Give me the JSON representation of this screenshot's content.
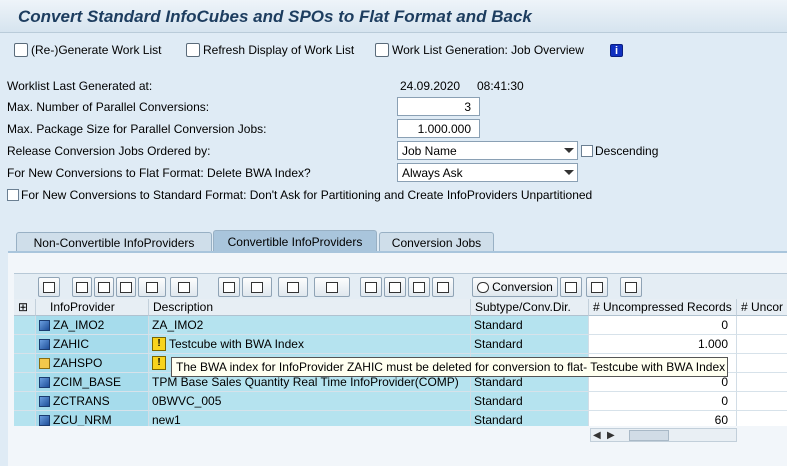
{
  "window": {
    "title": "Convert Standard InfoCubes and SPOs to Flat Format and Back"
  },
  "appbar": {
    "regen": "(Re-)Generate Work List",
    "refresh": "Refresh Display of Work List",
    "joboverview": "Work List Generation: Job Overview"
  },
  "form": {
    "last_generated_label": "Worklist Last Generated at:",
    "last_generated_date": "24.09.2020",
    "last_generated_time": "08:41:30",
    "max_parallel_label": "Max. Number of Parallel Conversions:",
    "max_parallel_value": "3",
    "max_package_label": "Max. Package Size for Parallel Conversion Jobs:",
    "max_package_value": "1.000.000",
    "release_order_label": "Release Conversion Jobs Ordered by:",
    "release_order_value": "Job Name",
    "descending_label": "Descending",
    "delete_bwa_label": "For New Conversions to Flat Format: Delete BWA Index?",
    "delete_bwa_value": "Always Ask",
    "partitioning_label": "For New Conversions to Standard Format: Don't Ask for Partitioning and Create InfoProviders Unpartitioned"
  },
  "tabs": [
    {
      "label": "Non-Convertible InfoProviders"
    },
    {
      "label": "Convertible InfoProviders"
    },
    {
      "label": "Conversion Jobs"
    }
  ],
  "toolbar": {
    "conversion": "Conversion"
  },
  "table": {
    "headers": [
      "InfoProvider",
      "Description",
      "Subtype/Conv.Dir.",
      "# Uncompressed Records",
      "# Uncor"
    ],
    "rows": [
      {
        "provider": "ZA_IMO2",
        "description": "ZA_IMO2",
        "subtype": "Standard",
        "records": "0"
      },
      {
        "provider": "ZAHIC",
        "description": "Testcube with BWA Index",
        "subtype": "Standard",
        "records": "1.000"
      },
      {
        "provider": "ZAHSPO",
        "description": "",
        "subtype": "",
        "records": ""
      },
      {
        "provider": "ZCIM_BASE",
        "description": "TPM Base Sales Quantity Real Time InfoProvider(COMP)",
        "subtype": "Standard",
        "records": "0"
      },
      {
        "provider": "ZCTRANS",
        "description": "0BWVC_005",
        "subtype": "Standard",
        "records": "0"
      },
      {
        "provider": "ZCU_NRM",
        "description": "new1",
        "subtype": "Standard",
        "records": "60"
      }
    ]
  },
  "tooltip": "The BWA index for InfoProvider ZAHIC must be deleted for conversion to flat- Testcube with BWA Index"
}
